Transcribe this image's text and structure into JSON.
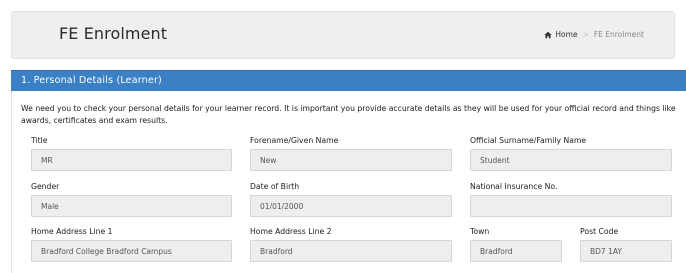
{
  "header": {
    "title": "FE Enrolment",
    "breadcrumb": {
      "home": "Home",
      "current": "FE Enrolment"
    }
  },
  "panel": {
    "title": "1. Personal Details (Learner)",
    "intro": "We need you to check your personal details for your learner record. It is important you provide accurate details as they will be used for your official record and things like awards, certificates and exam results."
  },
  "form": {
    "title_label": "Title",
    "title_value": "MR",
    "forename_label": "Forename/Given Name",
    "forename_value": "New",
    "surname_label": "Official Surname/Family Name",
    "surname_value": "Student",
    "gender_label": "Gender",
    "gender_value": "Male",
    "dob_label": "Date of Birth",
    "dob_value": "01/01/2000",
    "ni_label": "National Insurance No.",
    "ni_value": "",
    "address1_label": "Home Address Line 1",
    "address1_value": "Bradford College Bradford Campus",
    "address2_label": "Home Address Line 2",
    "address2_value": "Bradford",
    "town_label": "Town",
    "town_value": "Bradford",
    "postcode_label": "Post Code",
    "postcode_value": "BD7 1AY"
  }
}
